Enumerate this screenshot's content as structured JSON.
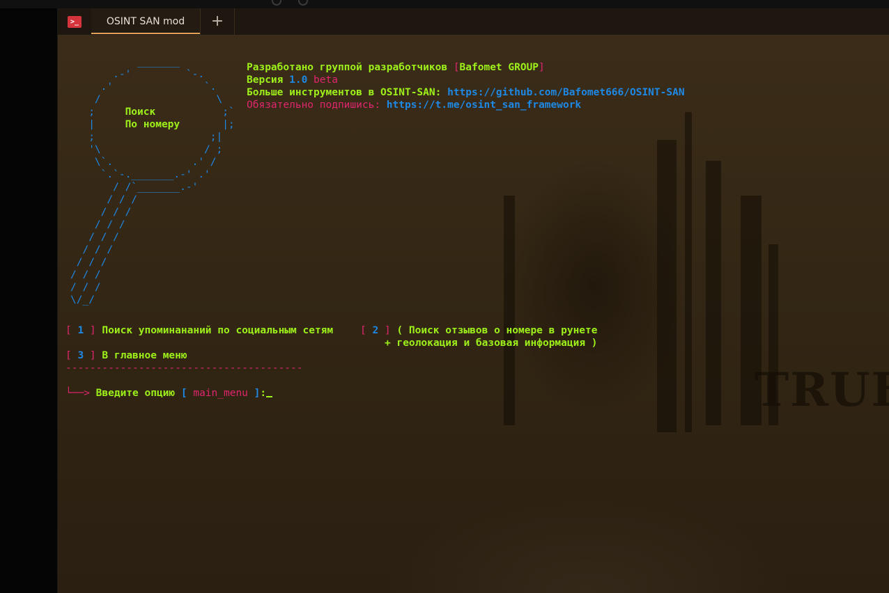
{
  "tab": {
    "title": "OSINT SAN mod",
    "new_tab_symbol": "+",
    "terminal_icon": "terminal-icon"
  },
  "art": {
    "label_line1": "Поиск",
    "label_line2": "По номеру"
  },
  "header": {
    "dev_prefix": "Разработано группой разработчиков ",
    "group_open": "[",
    "group_name": "Bafomet GROUP",
    "group_close": "]",
    "version_label": "Версия ",
    "version_number": "1.0",
    "version_tag": " beta",
    "more_tools_label": "Больше инструментов в OSINT-SAN: ",
    "more_tools_url": "https://github.com/Bafomet666/OSINT-SAN",
    "subscribe_label": "Обязательно подпишись: ",
    "subscribe_url": "https://t.me/osint_san_framework"
  },
  "menu": {
    "opt1_open": "[ ",
    "opt1_num": "1",
    "opt1_close": " ]",
    "opt1_text": " Поиск упоминананий по социальным сетям",
    "opt2_open": "[ ",
    "opt2_num": "2",
    "opt2_close": " ]",
    "opt2_text": " ( Поиск отзывов о номере в рунете",
    "opt2_text2": "+ геолокация и базовая информация )",
    "opt3_open": "[ ",
    "opt3_num": "3",
    "opt3_close": " ]",
    "opt3_text": " В главное меню",
    "separator": "---------------------------------------"
  },
  "prompt": {
    "arrow": "└──> ",
    "label": "Введите опцию ",
    "bracket_open": "[ ",
    "context": "main_menu",
    "bracket_close": " ]",
    "colon": ":"
  },
  "background": {
    "poster_text": "TRUE"
  },
  "colors": {
    "green": "#9ef01a",
    "blue": "#1e88e5",
    "pink": "#e0266e",
    "tab_accent": "#e3a25a",
    "icon_red": "#d6343c"
  }
}
